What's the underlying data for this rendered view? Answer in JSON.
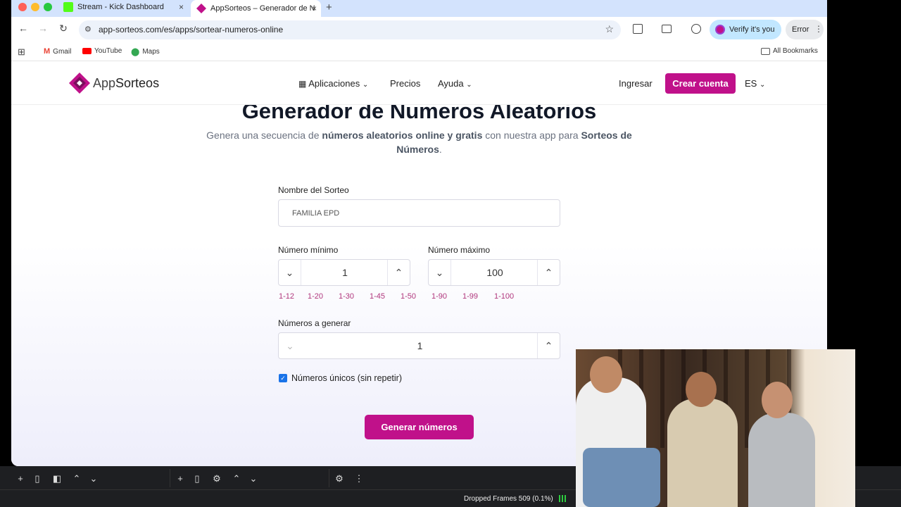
{
  "tabs": [
    {
      "title": "Stream - Kick Dashboard",
      "close": "×"
    },
    {
      "title": "AppSorteos – Generador de N",
      "close": "×"
    }
  ],
  "new_tab": "+",
  "address": {
    "url": "app-sorteos.com/es/apps/sortear-numeros-online"
  },
  "profile": {
    "label": "Verify it's you"
  },
  "error_label": "Error",
  "bookmarks": [
    {
      "label": "Gmail"
    },
    {
      "label": "YouTube"
    },
    {
      "label": "Maps"
    }
  ],
  "all_bookmarks": "All Bookmarks",
  "site": {
    "brand_app": "App",
    "brand_sorteos": "Sorteos",
    "nav": {
      "apps": "Aplicaciones",
      "pricing": "Precios",
      "help": "Ayuda"
    },
    "login": "Ingresar",
    "signup": "Crear cuenta",
    "lang": "ES"
  },
  "hero": {
    "title": "Generador de Numeros Aleatorios",
    "subtitle_parts": [
      "Genera una secuencia de ",
      "números aleatorios online y gratis",
      " con nuestra app para ",
      "Sorteos de Números",
      "."
    ]
  },
  "form": {
    "name_label": "Nombre del Sorteo",
    "name_value": "FAMILIA EPD",
    "min_label": "Número mínimo",
    "min_value": "1",
    "max_label": "Número máximo",
    "max_value": "100",
    "presets": [
      "1-12",
      "1-20",
      "1-30",
      "1-45",
      "1-50",
      "1-90",
      "1-99",
      "1-100"
    ],
    "count_label": "Números a generar",
    "count_value": "1",
    "unique_label": "Números únicos (sin repetir)",
    "unique_checked": true,
    "generate": "Generar números"
  },
  "obs": {
    "dropped_frames": "Dropped Frames 509 (0.1%)"
  },
  "colors": {
    "brand": "#c0118a",
    "tabbar": "#d3e3fd"
  }
}
